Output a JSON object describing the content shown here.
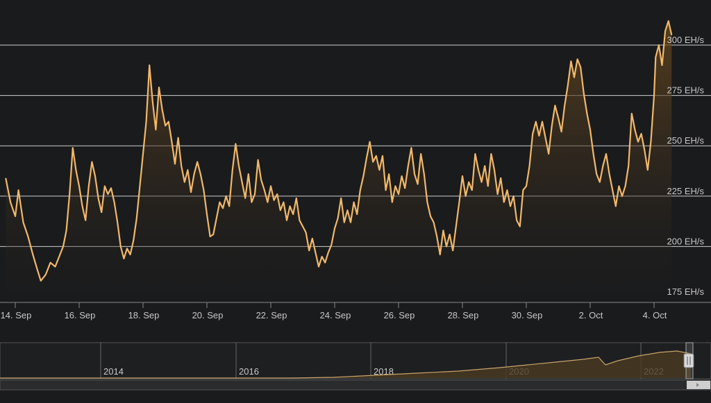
{
  "colors": {
    "background": "#1a1b1d",
    "line": "#f2b96a",
    "area_top": "#6a4a1f",
    "area_bottom": "#1a1b1d",
    "grid": "#d0d0d0",
    "text": "#c8c8c8",
    "navigator_line": "#c9a46a",
    "navigator_fill": "#4a3a22",
    "handle": "#d8d8d8"
  },
  "chart_data": {
    "type": "area",
    "title": "",
    "xlabel": "",
    "ylabel": "",
    "ylim": [
      175,
      300
    ],
    "y_ticks": [
      {
        "value": 175,
        "label": "175 EH/s"
      },
      {
        "value": 200,
        "label": "200 EH/s"
      },
      {
        "value": 225,
        "label": "225 EH/s"
      },
      {
        "value": 250,
        "label": "250 EH/s"
      },
      {
        "value": 275,
        "label": "275 EH/s"
      },
      {
        "value": 300,
        "label": "300 EH/s"
      }
    ],
    "x_ticks": [
      {
        "day": 14,
        "label": "14. Sep"
      },
      {
        "day": 16,
        "label": "16. Sep"
      },
      {
        "day": 18,
        "label": "18. Sep"
      },
      {
        "day": 20,
        "label": "20. Sep"
      },
      {
        "day": 22,
        "label": "22. Sep"
      },
      {
        "day": 24,
        "label": "24. Sep"
      },
      {
        "day": 26,
        "label": "26. Sep"
      },
      {
        "day": 28,
        "label": "28. Sep"
      },
      {
        "day": 30,
        "label": "30. Sep"
      },
      {
        "day": 32,
        "label": "2. Oct"
      },
      {
        "day": 34,
        "label": "4. Oct"
      }
    ],
    "grid": true,
    "series": [
      {
        "values": [
          [
            13.7,
            234
          ],
          [
            13.85,
            222
          ],
          [
            14.0,
            215
          ],
          [
            14.1,
            228
          ],
          [
            14.25,
            212
          ],
          [
            14.4,
            205
          ],
          [
            14.55,
            196
          ],
          [
            14.7,
            188
          ],
          [
            14.8,
            183
          ],
          [
            14.95,
            186
          ],
          [
            15.1,
            192
          ],
          [
            15.25,
            190
          ],
          [
            15.4,
            196
          ],
          [
            15.5,
            200
          ],
          [
            15.6,
            208
          ],
          [
            15.7,
            226
          ],
          [
            15.8,
            249
          ],
          [
            15.9,
            238
          ],
          [
            16.0,
            230
          ],
          [
            16.1,
            220
          ],
          [
            16.2,
            213
          ],
          [
            16.3,
            230
          ],
          [
            16.4,
            242
          ],
          [
            16.5,
            235
          ],
          [
            16.6,
            224
          ],
          [
            16.7,
            217
          ],
          [
            16.8,
            230
          ],
          [
            16.9,
            226
          ],
          [
            17.0,
            229
          ],
          [
            17.1,
            222
          ],
          [
            17.2,
            212
          ],
          [
            17.3,
            200
          ],
          [
            17.4,
            194
          ],
          [
            17.5,
            199
          ],
          [
            17.6,
            196
          ],
          [
            17.7,
            203
          ],
          [
            17.8,
            214
          ],
          [
            17.9,
            230
          ],
          [
            18.0,
            246
          ],
          [
            18.1,
            262
          ],
          [
            18.2,
            290
          ],
          [
            18.3,
            272
          ],
          [
            18.4,
            258
          ],
          [
            18.5,
            279
          ],
          [
            18.6,
            268
          ],
          [
            18.7,
            260
          ],
          [
            18.8,
            262
          ],
          [
            18.9,
            252
          ],
          [
            19.0,
            241
          ],
          [
            19.1,
            254
          ],
          [
            19.2,
            240
          ],
          [
            19.3,
            232
          ],
          [
            19.4,
            238
          ],
          [
            19.5,
            227
          ],
          [
            19.6,
            236
          ],
          [
            19.7,
            242
          ],
          [
            19.8,
            236
          ],
          [
            19.9,
            228
          ],
          [
            20.0,
            216
          ],
          [
            20.1,
            205
          ],
          [
            20.2,
            206
          ],
          [
            20.3,
            214
          ],
          [
            20.4,
            222
          ],
          [
            20.5,
            219
          ],
          [
            20.6,
            225
          ],
          [
            20.7,
            220
          ],
          [
            20.8,
            238
          ],
          [
            20.9,
            251
          ],
          [
            21.0,
            240
          ],
          [
            21.1,
            232
          ],
          [
            21.2,
            224
          ],
          [
            21.3,
            236
          ],
          [
            21.4,
            222
          ],
          [
            21.5,
            226
          ],
          [
            21.6,
            243
          ],
          [
            21.7,
            233
          ],
          [
            21.8,
            228
          ],
          [
            21.9,
            222
          ],
          [
            22.0,
            230
          ],
          [
            22.1,
            223
          ],
          [
            22.2,
            226
          ],
          [
            22.3,
            218
          ],
          [
            22.4,
            222
          ],
          [
            22.5,
            213
          ],
          [
            22.6,
            220
          ],
          [
            22.7,
            216
          ],
          [
            22.8,
            224
          ],
          [
            22.9,
            213
          ],
          [
            23.0,
            210
          ],
          [
            23.1,
            207
          ],
          [
            23.2,
            198
          ],
          [
            23.3,
            204
          ],
          [
            23.4,
            197
          ],
          [
            23.5,
            190
          ],
          [
            23.6,
            195
          ],
          [
            23.7,
            192
          ],
          [
            23.8,
            197
          ],
          [
            23.9,
            201
          ],
          [
            24.0,
            209
          ],
          [
            24.1,
            214
          ],
          [
            24.2,
            224
          ],
          [
            24.3,
            212
          ],
          [
            24.4,
            218
          ],
          [
            24.5,
            212
          ],
          [
            24.6,
            222
          ],
          [
            24.7,
            216
          ],
          [
            24.8,
            228
          ],
          [
            24.9,
            235
          ],
          [
            25.0,
            244
          ],
          [
            25.1,
            252
          ],
          [
            25.2,
            242
          ],
          [
            25.3,
            245
          ],
          [
            25.4,
            238
          ],
          [
            25.5,
            245
          ],
          [
            25.6,
            228
          ],
          [
            25.7,
            236
          ],
          [
            25.8,
            222
          ],
          [
            25.9,
            230
          ],
          [
            26.0,
            226
          ],
          [
            26.1,
            235
          ],
          [
            26.2,
            229
          ],
          [
            26.3,
            240
          ],
          [
            26.4,
            249
          ],
          [
            26.5,
            236
          ],
          [
            26.6,
            231
          ],
          [
            26.7,
            246
          ],
          [
            26.8,
            236
          ],
          [
            26.9,
            222
          ],
          [
            27.0,
            215
          ],
          [
            27.1,
            212
          ],
          [
            27.2,
            205
          ],
          [
            27.3,
            196
          ],
          [
            27.4,
            208
          ],
          [
            27.5,
            200
          ],
          [
            27.6,
            206
          ],
          [
            27.7,
            198
          ],
          [
            27.8,
            210
          ],
          [
            27.9,
            222
          ],
          [
            28.0,
            235
          ],
          [
            28.1,
            225
          ],
          [
            28.2,
            232
          ],
          [
            28.3,
            228
          ],
          [
            28.4,
            246
          ],
          [
            28.5,
            238
          ],
          [
            28.6,
            232
          ],
          [
            28.7,
            240
          ],
          [
            28.8,
            230
          ],
          [
            28.9,
            246
          ],
          [
            29.0,
            238
          ],
          [
            29.1,
            226
          ],
          [
            29.2,
            234
          ],
          [
            29.3,
            222
          ],
          [
            29.4,
            228
          ],
          [
            29.5,
            220
          ],
          [
            29.6,
            225
          ],
          [
            29.7,
            213
          ],
          [
            29.8,
            210
          ],
          [
            29.9,
            228
          ],
          [
            30.0,
            230
          ],
          [
            30.1,
            240
          ],
          [
            30.2,
            256
          ],
          [
            30.3,
            262
          ],
          [
            30.4,
            255
          ],
          [
            30.5,
            262
          ],
          [
            30.6,
            254
          ],
          [
            30.7,
            246
          ],
          [
            30.8,
            260
          ],
          [
            30.9,
            270
          ],
          [
            31.0,
            264
          ],
          [
            31.1,
            257
          ],
          [
            31.2,
            270
          ],
          [
            31.3,
            280
          ],
          [
            31.4,
            292
          ],
          [
            31.5,
            284
          ],
          [
            31.6,
            293
          ],
          [
            31.7,
            289
          ],
          [
            31.8,
            276
          ],
          [
            31.9,
            266
          ],
          [
            32.0,
            258
          ],
          [
            32.1,
            246
          ],
          [
            32.2,
            236
          ],
          [
            32.3,
            232
          ],
          [
            32.4,
            240
          ],
          [
            32.5,
            246
          ],
          [
            32.6,
            236
          ],
          [
            32.7,
            228
          ],
          [
            32.8,
            220
          ],
          [
            32.9,
            230
          ],
          [
            33.0,
            225
          ],
          [
            33.1,
            230
          ],
          [
            33.2,
            240
          ],
          [
            33.3,
            266
          ],
          [
            33.4,
            258
          ],
          [
            33.5,
            252
          ],
          [
            33.6,
            256
          ],
          [
            33.7,
            248
          ],
          [
            33.8,
            238
          ],
          [
            33.9,
            252
          ],
          [
            34.0,
            275
          ],
          [
            34.05,
            294
          ],
          [
            34.15,
            300
          ],
          [
            34.25,
            290
          ],
          [
            34.35,
            307
          ],
          [
            34.45,
            312
          ],
          [
            34.55,
            305
          ]
        ]
      }
    ]
  },
  "navigator": {
    "year_labels": [
      "2014",
      "2016",
      "2018",
      "2020",
      "2022"
    ],
    "grip_icon": "double-bar-grip"
  }
}
